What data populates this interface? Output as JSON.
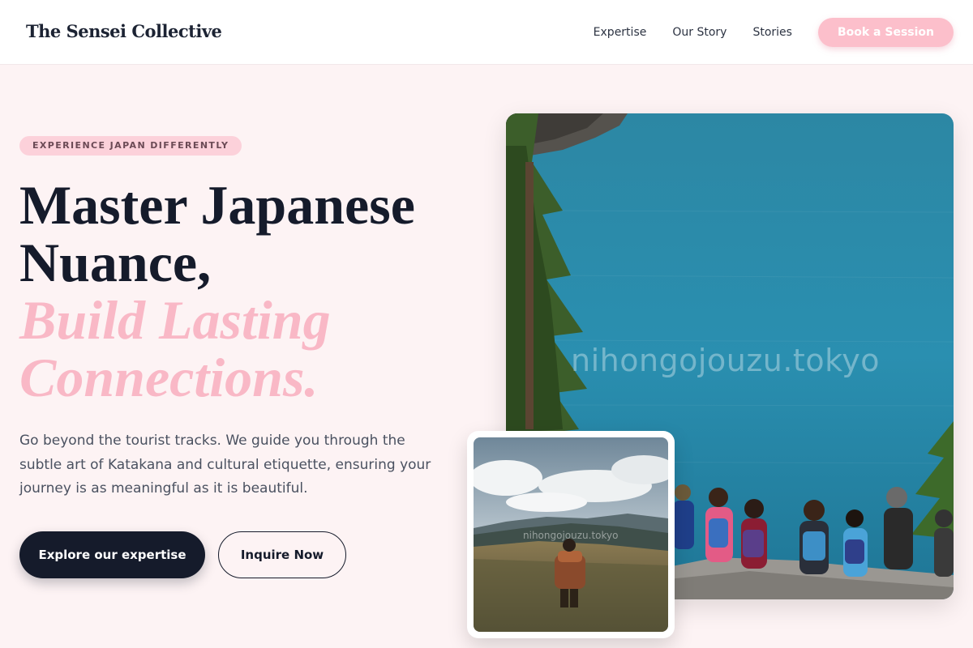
{
  "header": {
    "brand": "The Sensei Collective",
    "nav": [
      "Expertise",
      "Our Story",
      "Stories"
    ],
    "cta": "Book a Session"
  },
  "hero": {
    "badge": "EXPERIENCE JAPAN DIFFERENTLY",
    "title_line1": "Master Japanese",
    "title_line2": "Nuance,",
    "title_accent_line1": "Build Lasting",
    "title_accent_line2": "Connections.",
    "description": "Go beyond the tourist tracks. We guide you through the subtle art of Katakana and cultural etiquette, ensuring your journey is as meaningful as it is beautiful.",
    "primary_button": "Explore our expertise",
    "secondary_button": "Inquire Now"
  },
  "images": {
    "main_watermark": "nihongojouzu.tokyo",
    "small_watermark": "nihongojouzu.tokyo"
  },
  "colors": {
    "background": "#fdf3f4",
    "accent_pink": "#f9b8c6",
    "dark": "#151b2b"
  }
}
